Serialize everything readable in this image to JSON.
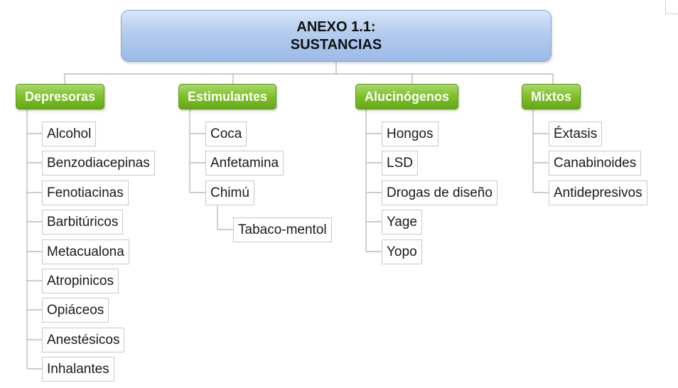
{
  "root": {
    "line1": "ANEXO 1.1:",
    "line2": "SUSTANCIAS"
  },
  "categories": [
    {
      "label": "Depresoras",
      "items": [
        "Alcohol",
        "Benzodiacepinas",
        "Fenotiacinas",
        "Barbitúricos",
        "Metacualona",
        "Atropinicos",
        "Opiáceos",
        "Anestésicos",
        "Inhalantes"
      ]
    },
    {
      "label": "Estimulantes",
      "items": [
        "Coca",
        "Anfetamina",
        "Chimú"
      ],
      "sub_items": [
        "Tabaco-mentol"
      ]
    },
    {
      "label": "Alucinógenos",
      "items": [
        "Hongos",
        "LSD",
        "Drogas de diseño",
        "Yage",
        "Yopo"
      ]
    },
    {
      "label": "Mixtos",
      "items": [
        "Éxtasis",
        "Canabinoides",
        "Antidepresivos"
      ]
    }
  ],
  "colors": {
    "root_fill": "#a9c5ec",
    "category_fill": "#7fbf2a",
    "connector": "#bcbcbc"
  }
}
